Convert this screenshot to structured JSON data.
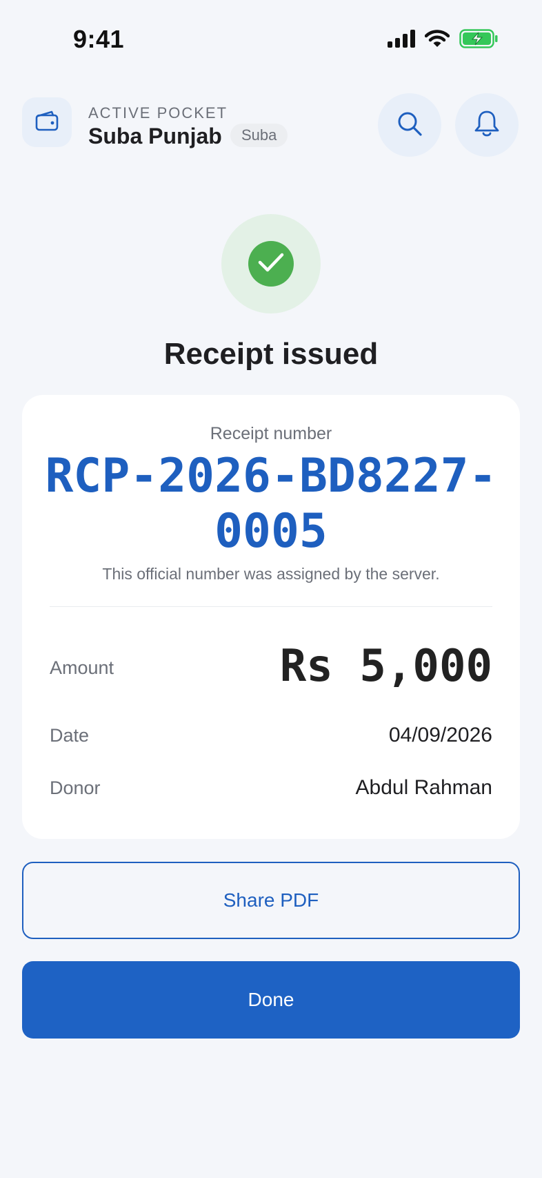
{
  "status_bar": {
    "time": "9:41",
    "icons": [
      "cellular-signal-icon",
      "wifi-icon",
      "battery-charging-icon"
    ]
  },
  "header": {
    "caption": "ACTIVE POCKET",
    "pocket_name": "Suba Punjab",
    "pocket_tag": "Suba",
    "icons": [
      "wallet-icon",
      "search-icon",
      "bell-icon"
    ]
  },
  "success": {
    "icon": "checkmark-icon",
    "title": "Receipt issued"
  },
  "receipt": {
    "caption": "Receipt number",
    "number": "RCP-2026-BD8227-0005",
    "note": "This official number was assigned by the server.",
    "amount_label": "Amount",
    "amount_value": "Rs 5,000",
    "date_label": "Date",
    "date_value": "04/09/2026",
    "donor_label": "Donor",
    "donor_value": "Abdul Rahman"
  },
  "actions": {
    "share_label": "Share PDF",
    "done_label": "Done"
  },
  "colors": {
    "accent": "#1e5fbf",
    "success": "#4caf50",
    "background": "#f4f6fa",
    "battery": "#34c759"
  }
}
